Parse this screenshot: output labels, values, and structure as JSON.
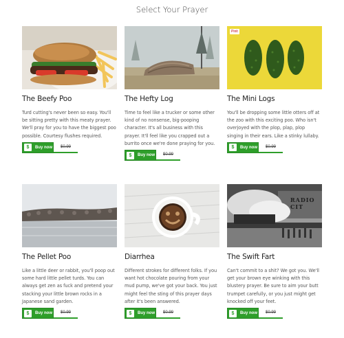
{
  "page": {
    "title": "Select Your Prayer"
  },
  "colors": {
    "accent": "#2e9e2a"
  },
  "products": [
    {
      "title": "The Beefy Poo",
      "description": "Turd cutting's never been so easy. You'll be sitting pretty with this meaty prayer. We'll pray for you to have the biggest poo possible. Courtesy flushes required.",
      "buy_label": "Buy now",
      "buy_icon": "$",
      "price": "$0.99",
      "image": "burger-photo"
    },
    {
      "title": "The Hefty Log",
      "description": "Time to feel like a trucker or some other kind of no nonsense, big-pooping character. It's all business with this prayer. It'll feel like you crapped out a burrito once we're done praying for you.",
      "buy_label": "Buy now",
      "buy_icon": "$",
      "price": "$0.99",
      "image": "log-pile-photo"
    },
    {
      "title": "The Mini Logs",
      "description": "You'll be dropping some little otters off at the zoo with this exciting poo. Who isn't overjoyed with the plop, plap, plop singing in their ears. Like a stinky lullaby.",
      "buy_label": "Buy now",
      "buy_icon": "$",
      "price": "$0.99",
      "image": "pickles-photo",
      "image_badge": "Pinit"
    },
    {
      "title": "The Pellet Poo",
      "description": "Like a little deer or rabbit, you'll poop out some hard little pellet turds. You can always get zen as fuck and pretend your stacking your little brown rocks in a Japanese sand garden.",
      "buy_label": "Buy now",
      "buy_icon": "$",
      "price": "$0.99",
      "image": "pebble-breakwater-photo"
    },
    {
      "title": "Diarrhea",
      "description": "Different strokes for different folks. If you want hot chocolate pouring from your mud pump, we've got your back. You just might feel the sting of this prayer days after it's been answered.",
      "buy_label": "Buy now",
      "buy_icon": "$",
      "price": "$0.99",
      "image": "coffee-cup-photo"
    },
    {
      "title": "The Swift Fart",
      "description": "Can't commit to a shit? We got you. We'll get your brown eye winking with this blustery prayer. Be sure to aim your butt trumpet carefully, or you just might get knocked off your feet.",
      "buy_label": "Buy now",
      "buy_icon": "$",
      "price": "$0.99",
      "image": "steam-train-photo",
      "image_sign": "RADIO CIT"
    }
  ]
}
